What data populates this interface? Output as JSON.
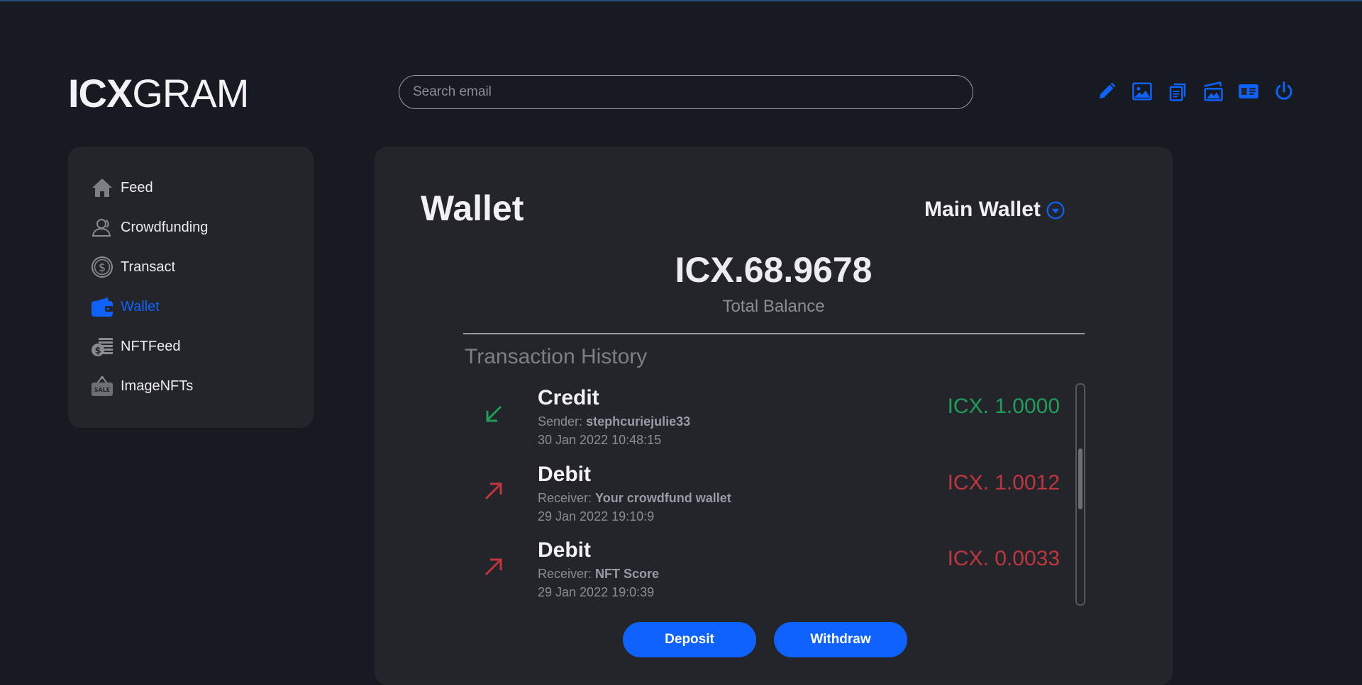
{
  "app": {
    "logo_bold": "ICX",
    "logo_regular": "GRAM"
  },
  "search": {
    "placeholder": "Search email",
    "value": ""
  },
  "toolbar": {
    "accent": "#0f62fe",
    "icons": [
      "pencil-icon",
      "image-icon",
      "documents-icon",
      "media-post-icon",
      "id-card-icon",
      "power-icon"
    ]
  },
  "sidebar": {
    "items": [
      {
        "label": "Feed",
        "icon": "home-icon",
        "active": false
      },
      {
        "label": "Crowdfunding",
        "icon": "people-icon",
        "active": false
      },
      {
        "label": "Transact",
        "icon": "dollar-coin-icon",
        "active": false
      },
      {
        "label": "Wallet",
        "icon": "wallet-icon",
        "active": true
      },
      {
        "label": "NFTFeed",
        "icon": "money-stack-icon",
        "active": false
      },
      {
        "label": "ImageNFTs",
        "icon": "sale-tag-icon",
        "active": false
      }
    ]
  },
  "wallet": {
    "title": "Wallet",
    "selected_wallet": "Main Wallet",
    "balance": "ICX.68.9678",
    "balance_label": "Total Balance",
    "history_title": "Transaction History",
    "transactions": [
      {
        "type": "Credit",
        "party_label": "Sender:",
        "party": "stephcuriejulie33",
        "date": "30 Jan 2022 10:48:15",
        "amount": "ICX. 1.0000",
        "direction": "in",
        "color": "#1e9e5a"
      },
      {
        "type": "Debit",
        "party_label": "Receiver:",
        "party": "Your crowdfund wallet",
        "date": "29 Jan 2022 19:10:9",
        "amount": "ICX. 1.0012",
        "direction": "out",
        "color": "#c0363f"
      },
      {
        "type": "Debit",
        "party_label": "Receiver:",
        "party": "NFT Score",
        "date": "29 Jan 2022 19:0:39",
        "amount": "ICX. 0.0033",
        "direction": "out",
        "color": "#c0363f"
      }
    ],
    "deposit_label": "Deposit",
    "withdraw_label": "Withdraw"
  }
}
